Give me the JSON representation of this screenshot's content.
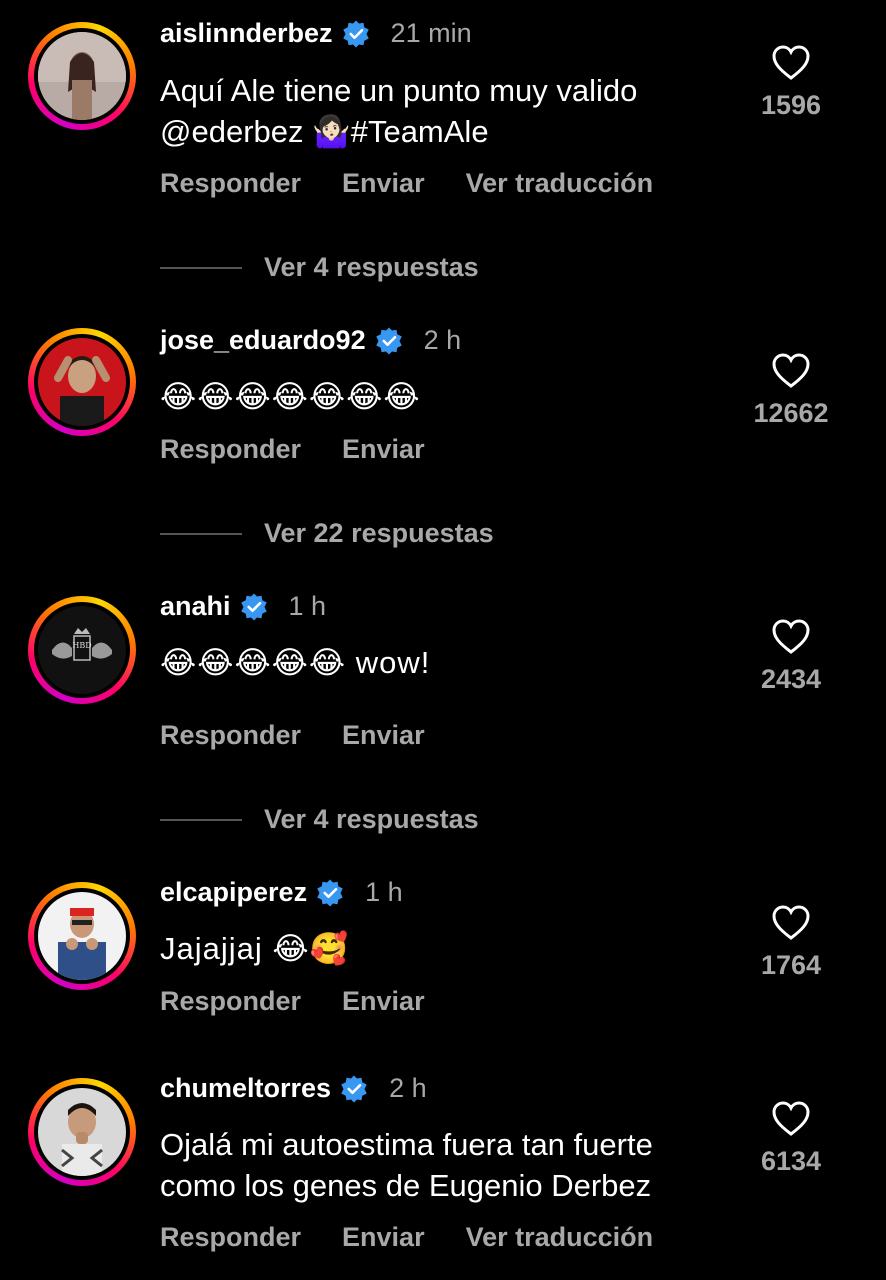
{
  "actions": {
    "reply": "Responder",
    "send": "Enviar",
    "translate": "Ver traducción"
  },
  "comments": [
    {
      "username": "aislinnderbez",
      "time": "21 min",
      "text_line1": "Aquí Ale tiene un punto muy valido",
      "text_line2": "@ederbez 🤷🏻‍♀️#TeamAle",
      "likes": "1596",
      "replies": "Ver 4 respuestas",
      "show_translate": true
    },
    {
      "username": "jose_eduardo92",
      "time": "2 h",
      "text_line1": "😂😂😂😂😂😂😂",
      "likes": "12662",
      "replies": "Ver 22 respuestas"
    },
    {
      "username": "anahi",
      "time": "1 h",
      "text_line1": "😂😂😂😂😂 wow!",
      "likes": "2434",
      "replies": "Ver 4 respuestas"
    },
    {
      "username": "elcapiperez",
      "time": "1 h",
      "text_line1": "Jajajjaj 😂🥰",
      "likes": "1764"
    },
    {
      "username": "chumeltorres",
      "time": "2 h",
      "text_line1": "Ojalá mi autoestima fuera tan fuerte",
      "text_line2": "como los genes de Eugenio Derbez",
      "likes": "6134",
      "show_translate": true
    }
  ],
  "colors": {
    "background": "#000000",
    "secondary_text": "#a8a8a8",
    "verified": "#3897f0"
  },
  "icons": {
    "verified": "verified-badge-icon",
    "like": "heart-outline-icon"
  }
}
